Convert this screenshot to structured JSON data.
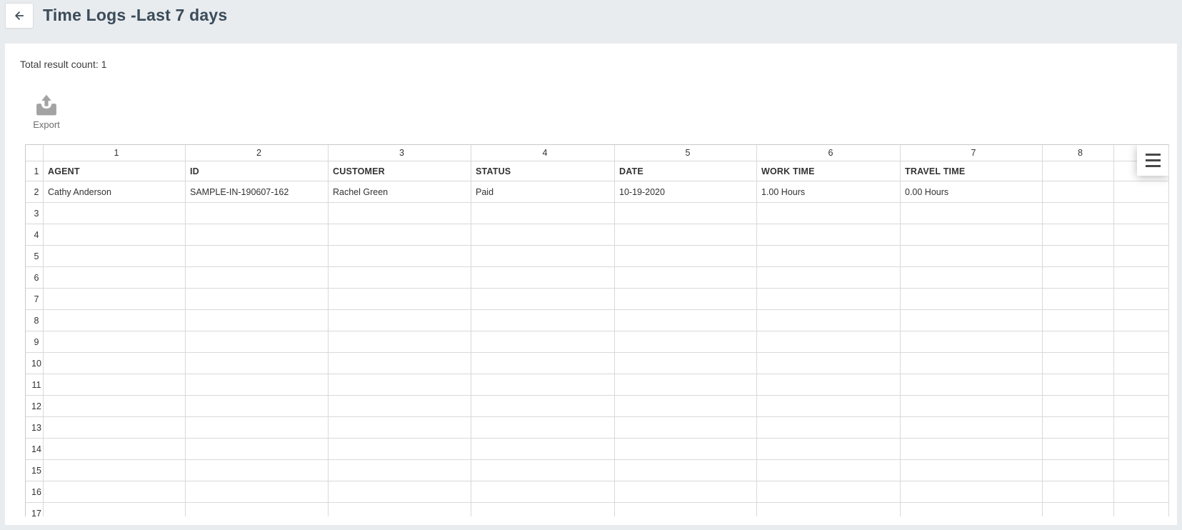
{
  "header": {
    "title": "Time Logs -Last 7 days"
  },
  "summary": {
    "total_count_text": "Total result count: 1"
  },
  "toolbar": {
    "export_label": "Export"
  },
  "icons": {
    "back": "left-arrow-icon",
    "export": "export-tray-up-arrow-icon",
    "menu": "hamburger-menu-icon"
  },
  "grid": {
    "column_numbers": [
      "1",
      "2",
      "3",
      "4",
      "5",
      "6",
      "7",
      "8",
      ""
    ],
    "row_numbers": [
      "1",
      "2",
      "3",
      "4",
      "5",
      "6",
      "7",
      "8",
      "9",
      "10",
      "11",
      "12",
      "13",
      "14",
      "15",
      "16",
      "17"
    ],
    "field_headers": [
      "AGENT",
      "ID",
      "CUSTOMER",
      "STATUS",
      "DATE",
      "WORK TIME",
      "TRAVEL TIME"
    ],
    "data_rows": [
      [
        "Cathy Anderson",
        "SAMPLE-IN-190607-162",
        "Rachel Green",
        "Paid",
        "10-19-2020",
        "1.00 Hours",
        "0.00 Hours"
      ]
    ]
  },
  "colors": {
    "page_bg": "#e8ecef",
    "panel_bg": "#ffffff",
    "title_text": "#3b4b59",
    "header_row_bg": "#d9d9d9",
    "gutter_bg": "#efefef",
    "grid_border": "#d9d9d9",
    "data_text": "#323232",
    "muted_text": "#a2a2a2"
  }
}
